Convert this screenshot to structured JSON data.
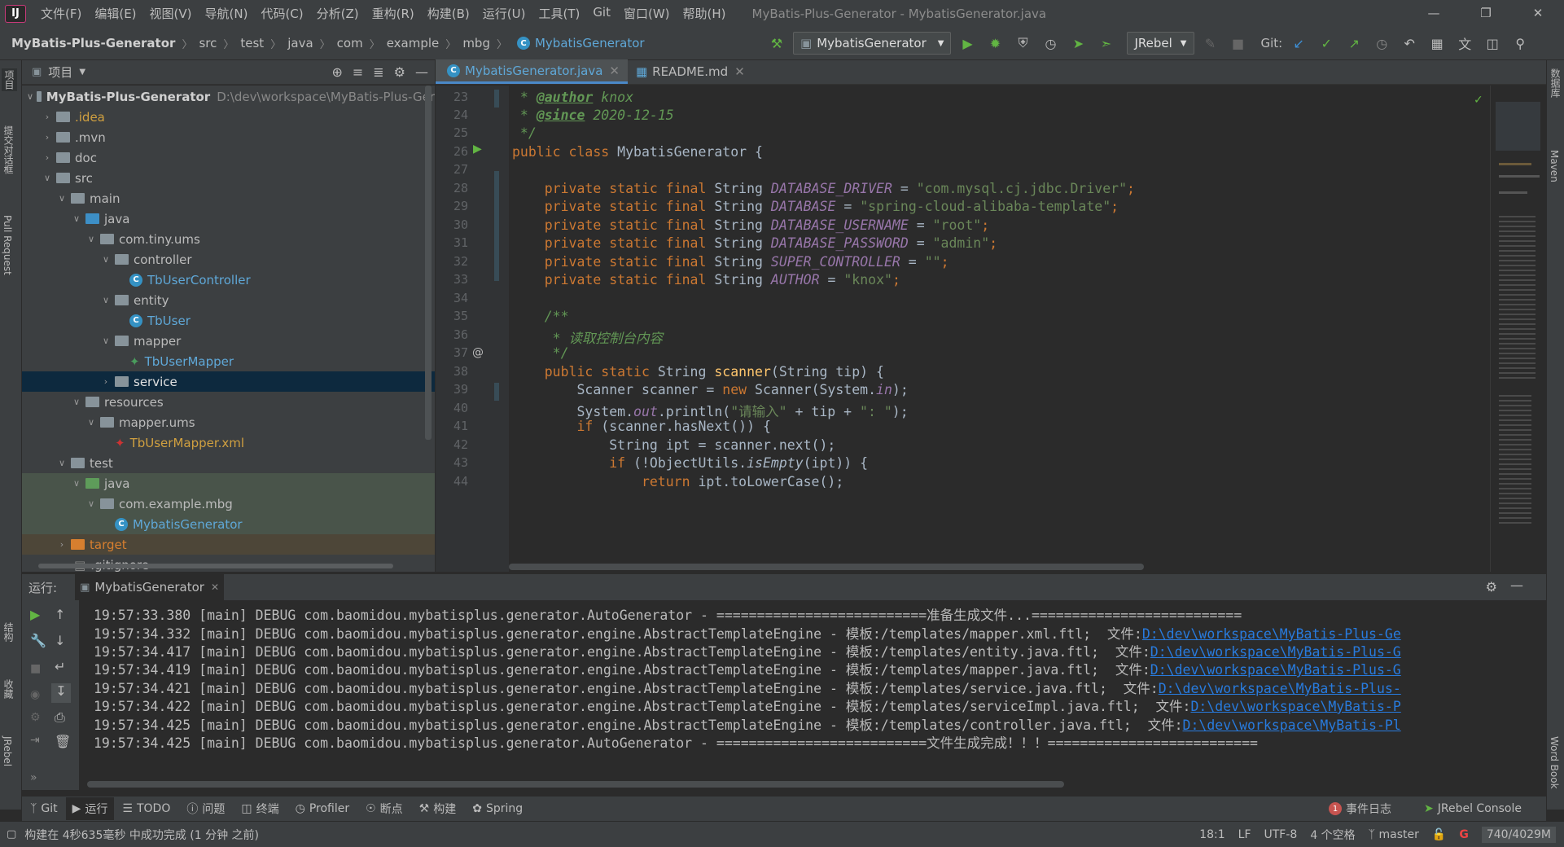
{
  "menu": {
    "logo": "IJ",
    "items": [
      "文件(F)",
      "编辑(E)",
      "视图(V)",
      "导航(N)",
      "代码(C)",
      "分析(Z)",
      "重构(R)",
      "构建(B)",
      "运行(U)",
      "工具(T)",
      "Git",
      "窗口(W)",
      "帮助(H)"
    ],
    "window_title": "MyBatis-Plus-Generator - MybatisGenerator.java"
  },
  "breadcrumb": [
    "MyBatis-Plus-Generator",
    "src",
    "test",
    "java",
    "com",
    "example",
    "mbg",
    "MybatisGenerator"
  ],
  "toolbar": {
    "run_config": "MybatisGenerator",
    "jrebel": "JRebel",
    "git_label": "Git:"
  },
  "left_strip": {
    "project": "项目",
    "commit": "提交对话框",
    "pull": "Pull Request",
    "structure": "结构",
    "favorites": "收藏",
    "jrebel": "JRebel"
  },
  "right_strip": {
    "database": "数据库",
    "maven": "Maven",
    "wordbook": "Word Book"
  },
  "project_panel": {
    "title": "项目",
    "root": "MyBatis-Plus-Generator",
    "root_path": "D:\\dev\\workspace\\MyBatis-Plus-Ger",
    "tree": [
      {
        "label": ".idea"
      },
      {
        "label": ".mvn"
      },
      {
        "label": "doc"
      },
      {
        "label": "src"
      },
      {
        "label": "main"
      },
      {
        "label": "java"
      },
      {
        "label": "com.tiny.ums"
      },
      {
        "label": "controller"
      },
      {
        "label": "TbUserController"
      },
      {
        "label": "entity"
      },
      {
        "label": "TbUser"
      },
      {
        "label": "mapper"
      },
      {
        "label": "TbUserMapper"
      },
      {
        "label": "service"
      },
      {
        "label": "resources"
      },
      {
        "label": "mapper.ums"
      },
      {
        "label": "TbUserMapper.xml"
      },
      {
        "label": "test"
      },
      {
        "label": "java"
      },
      {
        "label": "com.example.mbg"
      },
      {
        "label": "MybatisGenerator"
      },
      {
        "label": "target"
      },
      {
        "label": ".gitignore"
      }
    ]
  },
  "editor": {
    "tabs": [
      {
        "label": "MybatisGenerator.java"
      },
      {
        "label": "README.md"
      }
    ],
    "line_numbers": [
      "23",
      "24",
      "25",
      "26",
      "27",
      "28",
      "29",
      "30",
      "31",
      "32",
      "33",
      "34",
      "35",
      "36",
      "37",
      "38",
      "39",
      "40",
      "41",
      "42",
      "43",
      "44"
    ],
    "code": {
      "l23_a": " * ",
      "l23_tag": "@author",
      "l23_b": " knox",
      "l24_a": " * ",
      "l24_tag": "@since",
      "l24_b": " 2020-12-15",
      "l25": " */",
      "l26_kw": "public class ",
      "l26_rest": "MybatisGenerator {",
      "pre": "private static final ",
      "type": "String ",
      "f1": "DATABASE_DRIVER",
      "v1": "\"com.mysql.cj.jdbc.Driver\"",
      "f2": "DATABASE",
      "v2": "\"spring-cloud-alibaba-template\"",
      "f3": "DATABASE_USERNAME",
      "v3": "\"root\"",
      "f4": "DATABASE_PASSWORD",
      "v4": "\"admin\"",
      "f5": "SUPER_CONTROLLER",
      "v5": "\"\"",
      "f6": "AUTHOR",
      "v6": "\"knox\"",
      "eq": " = ",
      "semi": ";",
      "l35": "    /**",
      "l36": "     * 读取控制台内容",
      "l37": "     */",
      "l38_kw": "    public static ",
      "l38_type": "String ",
      "l38_fn": "scanner",
      "l38_rest": "(String tip) {",
      "l39_a": "        Scanner scanner = ",
      "l39_kw": "new ",
      "l39_b": "Scanner(System.",
      "l39_st": "in",
      "l39_c": ");",
      "l40_a": "        System.",
      "l40_st": "out",
      "l40_b": ".println(",
      "l40_s1": "\"请输入\"",
      "l40_c": " + tip + ",
      "l40_s2": "\": \"",
      "l40_d": ");",
      "l41_kw": "        if ",
      "l41_rest": "(scanner.hasNext()) {",
      "l42": "            String ipt = scanner.next();",
      "l43_kw": "            if ",
      "l43_a": "(!ObjectUtils.",
      "l43_st": "isEmpty",
      "l43_b": "(ipt)) {",
      "l44_kw": "                return ",
      "l44_rest": "ipt.toLowerCase();"
    }
  },
  "run": {
    "label": "运行:",
    "tab": "MybatisGenerator",
    "lines": [
      {
        "t": "19:57:33.380 [main] DEBUG com.baomidou.mybatisplus.generator.AutoGenerator - ==========================准备生成文件...==========================",
        "link": ""
      },
      {
        "t": "19:57:34.332 [main] DEBUG com.baomidou.mybatisplus.generator.engine.AbstractTemplateEngine - 模板:/templates/mapper.xml.ftl;  文件:",
        "link": "D:\\dev\\workspace\\MyBatis-Plus-Ge"
      },
      {
        "t": "19:57:34.417 [main] DEBUG com.baomidou.mybatisplus.generator.engine.AbstractTemplateEngine - 模板:/templates/entity.java.ftl;  文件:",
        "link": "D:\\dev\\workspace\\MyBatis-Plus-G"
      },
      {
        "t": "19:57:34.419 [main] DEBUG com.baomidou.mybatisplus.generator.engine.AbstractTemplateEngine - 模板:/templates/mapper.java.ftl;  文件:",
        "link": "D:\\dev\\workspace\\MyBatis-Plus-G"
      },
      {
        "t": "19:57:34.421 [main] DEBUG com.baomidou.mybatisplus.generator.engine.AbstractTemplateEngine - 模板:/templates/service.java.ftl;  文件:",
        "link": "D:\\dev\\workspace\\MyBatis-Plus-"
      },
      {
        "t": "19:57:34.422 [main] DEBUG com.baomidou.mybatisplus.generator.engine.AbstractTemplateEngine - 模板:/templates/serviceImpl.java.ftl;  文件:",
        "link": "D:\\dev\\workspace\\MyBatis-P"
      },
      {
        "t": "19:57:34.425 [main] DEBUG com.baomidou.mybatisplus.generator.engine.AbstractTemplateEngine - 模板:/templates/controller.java.ftl;  文件:",
        "link": "D:\\dev\\workspace\\MyBatis-Pl"
      },
      {
        "t": "19:57:34.425 [main] DEBUG com.baomidou.mybatisplus.generator.AutoGenerator - ==========================文件生成完成！！！==========================",
        "link": ""
      }
    ]
  },
  "bottom_tabs": [
    "Git",
    "运行",
    "TODO",
    "问题",
    "终端",
    "Profiler",
    "断点",
    "构建",
    "Spring"
  ],
  "bottom_right": {
    "event_log": "事件日志",
    "jrebel_console": "JRebel Console",
    "event_count": "1"
  },
  "status": {
    "message": "构建在 4秒635毫秒 中成功完成 (1 分钟 之前)",
    "position": "18:1",
    "line_sep": "LF",
    "encoding": "UTF-8",
    "indent": "4 个空格",
    "branch": "master",
    "memory": "740/4029M"
  }
}
